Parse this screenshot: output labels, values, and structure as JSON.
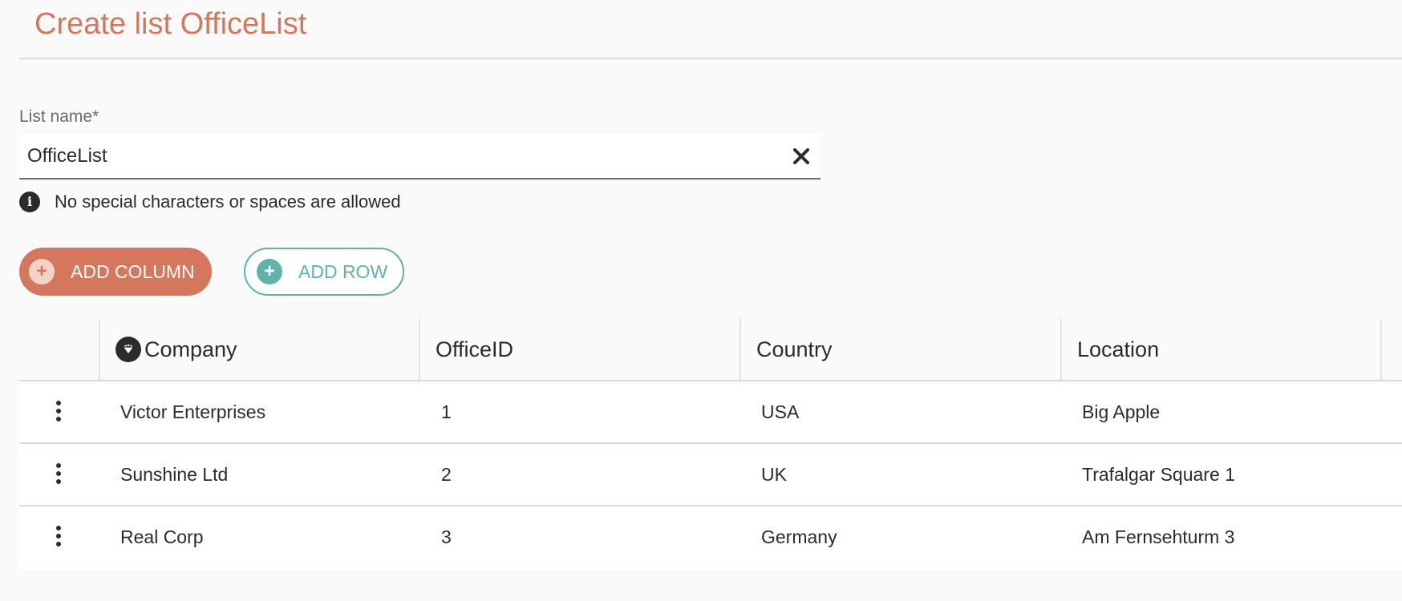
{
  "page": {
    "title": "Create list OfficeList"
  },
  "form": {
    "list_name_label": "List name*",
    "list_name_value": "OfficeList",
    "hint": "No special characters or spaces are allowed"
  },
  "toolbar": {
    "add_column_label": "ADD COLUMN",
    "add_row_label": "ADD ROW"
  },
  "table": {
    "columns": [
      "Company",
      "OfficeID",
      "Country",
      "Location"
    ],
    "rows": [
      [
        "Victor Enterprises",
        "1",
        "USA",
        "Big Apple"
      ],
      [
        "Sunshine Ltd",
        "2",
        "UK",
        "Trafalgar Square 1"
      ],
      [
        "Real Corp",
        "3",
        "Germany",
        "Am Fernsehturm 3"
      ]
    ]
  },
  "icons": {
    "clear": "close-icon",
    "hint": "info-icon",
    "add_column": "plus-icon",
    "add_row": "plus-icon",
    "key_column": "diamond-icon",
    "row_menu": "kebab-menu-icon"
  },
  "colors": {
    "accent": "#d4775c",
    "secondary": "#5fb3a8",
    "text": "#2b2b2b"
  }
}
